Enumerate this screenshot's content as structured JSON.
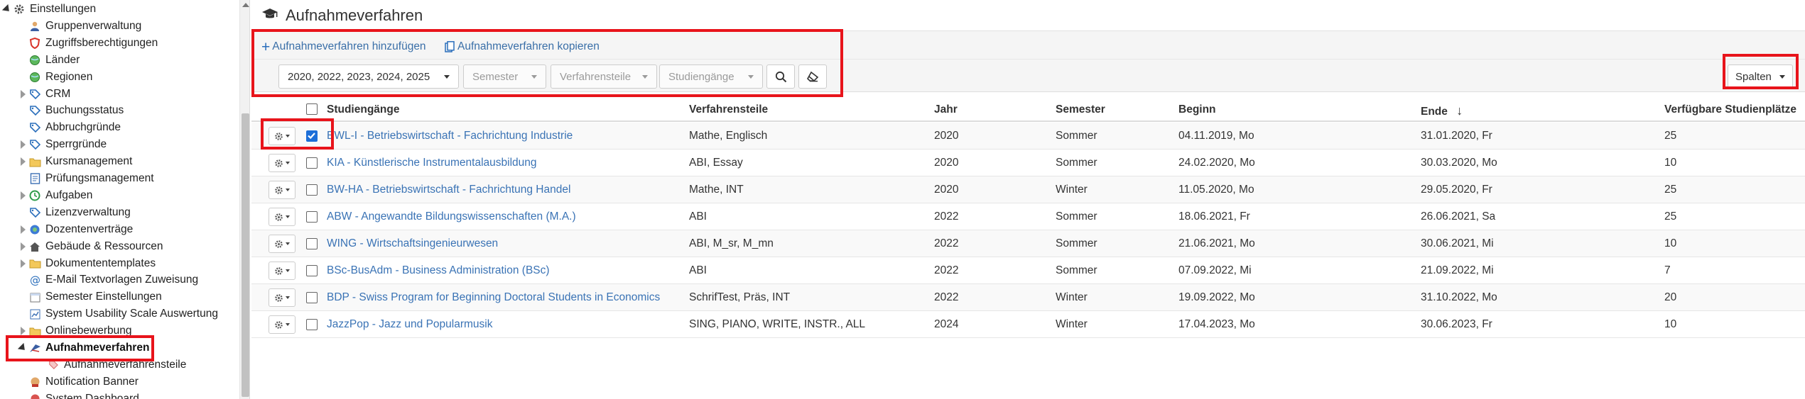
{
  "sidebar": {
    "items": [
      {
        "label": "Einstellungen",
        "icon": "gear-icon"
      },
      {
        "label": "Gruppenverwaltung",
        "icon": "user-group-icon"
      },
      {
        "label": "Zugriffsberechtigungen",
        "icon": "shield-icon"
      },
      {
        "label": "Länder",
        "icon": "globe-icon"
      },
      {
        "label": "Regionen",
        "icon": "globe-icon"
      },
      {
        "label": "CRM",
        "icon": "tag-icon"
      },
      {
        "label": "Buchungsstatus",
        "icon": "tag-icon"
      },
      {
        "label": "Abbruchgründe",
        "icon": "tag-icon"
      },
      {
        "label": "Sperrgründe",
        "icon": "tag-icon"
      },
      {
        "label": "Kursmanagement",
        "icon": "folder-icon"
      },
      {
        "label": "Prüfungsmanagement",
        "icon": "exam-icon"
      },
      {
        "label": "Aufgaben",
        "icon": "clock-icon"
      },
      {
        "label": "Lizenzverwaltung",
        "icon": "tag-icon"
      },
      {
        "label": "Dozentenverträge",
        "icon": "contract-icon"
      },
      {
        "label": "Gebäude & Ressourcen",
        "icon": "building-icon"
      },
      {
        "label": "Dokumententemplates",
        "icon": "folder-icon"
      },
      {
        "label": "E-Mail Textvorlagen Zuweisung",
        "icon": "at-icon"
      },
      {
        "label": "Semester Einstellungen",
        "icon": "calendar-icon"
      },
      {
        "label": "System Usability Scale Auswertung",
        "icon": "chart-icon"
      },
      {
        "label": "Onlinebewerbung",
        "icon": "folder-icon"
      },
      {
        "label": "Aufnahmeverfahren",
        "icon": "graduation-icon"
      },
      {
        "label": "Aufnahmeverfahrensteile",
        "icon": "tag-small-icon"
      },
      {
        "label": "Notification Banner",
        "icon": "banner-icon"
      },
      {
        "label": "System Dashboard",
        "icon": "dashboard-icon"
      }
    ]
  },
  "header": {
    "title": "Aufnahmeverfahren",
    "icon": "graduation-cap-icon"
  },
  "toolbar": {
    "add_label": "Aufnahmeverfahren hinzufügen",
    "copy_label": "Aufnahmeverfahren kopieren"
  },
  "filters": {
    "jahr": "2020, 2022, 2023, 2024, 2025",
    "semester": "Semester",
    "verfahrensteile": "Verfahrensteile",
    "studiengaenge": "Studiengänge",
    "spalten": "Spalten"
  },
  "table": {
    "columns": [
      "Studiengänge",
      "Verfahrensteile",
      "Jahr",
      "Semester",
      "Beginn",
      "Ende",
      "Verfügbare Studienplätze"
    ],
    "sort_indicator": "↓",
    "rows": [
      {
        "studiengang": "BWL-I - Betriebswirtschaft - Fachrichtung Industrie",
        "verfahrensteile": "Mathe, Englisch",
        "jahr": "2020",
        "semester": "Sommer",
        "beginn": "04.11.2019, Mo",
        "ende": "31.01.2020, Fr",
        "plaetze": "25",
        "checked": true
      },
      {
        "studiengang": "KIA - Künstlerische Instrumentalausbildung",
        "verfahrensteile": "ABI, Essay",
        "jahr": "2020",
        "semester": "Sommer",
        "beginn": "24.02.2020, Mo",
        "ende": "30.03.2020, Mo",
        "plaetze": "10",
        "checked": false
      },
      {
        "studiengang": "BW-HA - Betriebswirtschaft - Fachrichtung Handel",
        "verfahrensteile": "Mathe, INT",
        "jahr": "2020",
        "semester": "Winter",
        "beginn": "11.05.2020, Mo",
        "ende": "29.05.2020, Fr",
        "plaetze": "25",
        "checked": false
      },
      {
        "studiengang": "ABW - Angewandte Bildungswissenschaften (M.A.)",
        "verfahrensteile": "ABI",
        "jahr": "2022",
        "semester": "Sommer",
        "beginn": "18.06.2021, Fr",
        "ende": "26.06.2021, Sa",
        "plaetze": "25",
        "checked": false
      },
      {
        "studiengang": "WING - Wirtschaftsingenieurwesen",
        "verfahrensteile": "ABI, M_sr, M_mn",
        "jahr": "2022",
        "semester": "Sommer",
        "beginn": "21.06.2021, Mo",
        "ende": "30.06.2021, Mi",
        "plaetze": "10",
        "checked": false
      },
      {
        "studiengang": "BSc-BusAdm - Business Administration (BSc)",
        "verfahrensteile": "ABI",
        "jahr": "2022",
        "semester": "Sommer",
        "beginn": "07.09.2022, Mi",
        "ende": "21.09.2022, Mi",
        "plaetze": "7",
        "checked": false
      },
      {
        "studiengang": "BDP - Swiss Program for Beginning Doctoral Students in Economics",
        "verfahrensteile": "SchrifTest, Präs, INT",
        "jahr": "2022",
        "semester": "Winter",
        "beginn": "19.09.2022, Mo",
        "ende": "31.10.2022, Mo",
        "plaetze": "20",
        "checked": false
      },
      {
        "studiengang": "JazzPop - Jazz und Popularmusik",
        "verfahrensteile": "SING, PIANO, WRITE, INSTR., ALL",
        "jahr": "2024",
        "semester": "Winter",
        "beginn": "17.04.2023, Mo",
        "ende": "30.06.2023, Fr",
        "plaetze": "10",
        "checked": false
      }
    ]
  },
  "colors": {
    "link": "#3a73b5",
    "highlight_border": "#e8141b",
    "checkbox_checked": "#1d6fd8"
  }
}
